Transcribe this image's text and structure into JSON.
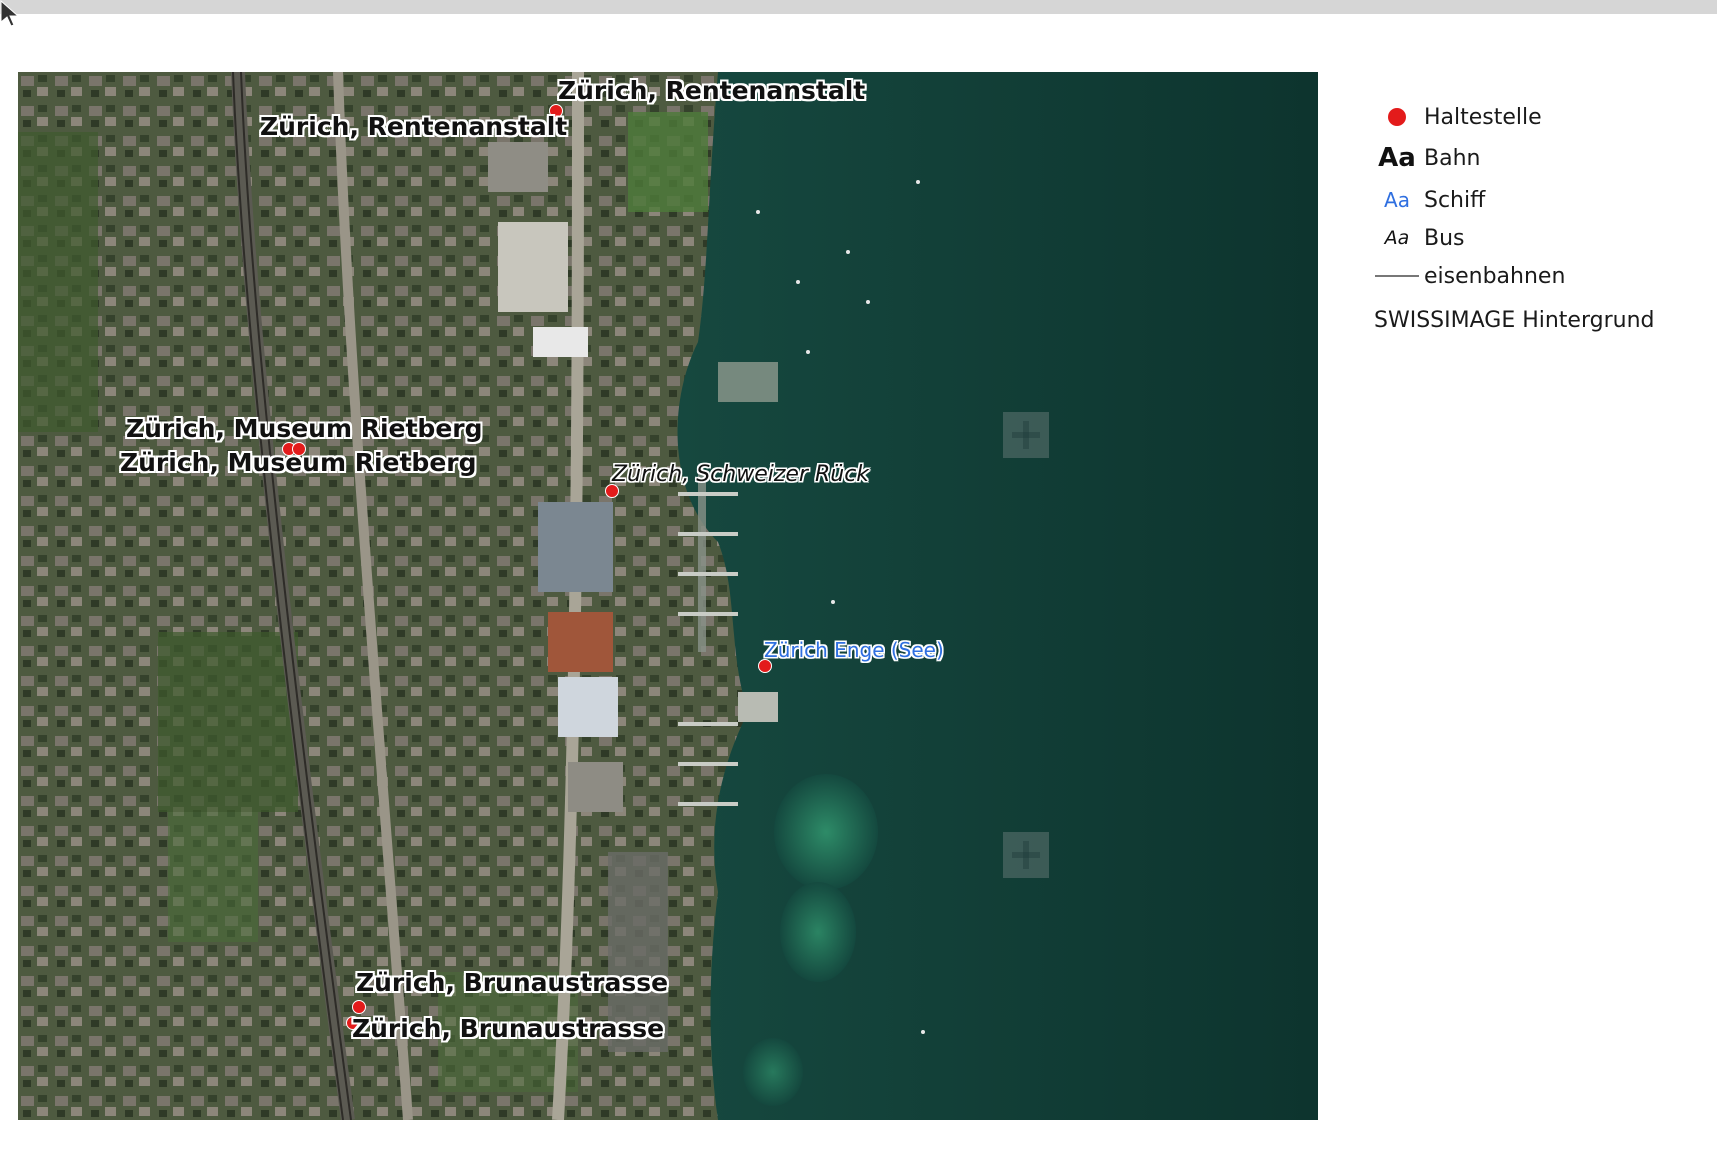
{
  "map": {
    "stops": {
      "rentenanstalt": {
        "label_top": "Zürich, Rentenanstalt",
        "label_bottom": "Zürich, Rentenanstalt"
      },
      "museum_rietberg": {
        "label_top": "Zürich, Museum Rietberg",
        "label_bottom": "Zürich, Museum Rietberg"
      },
      "schweizer_rueck": {
        "label": "Zürich, Schweizer Rück"
      },
      "enge_see": {
        "label": "Zürich Enge (See)"
      },
      "brunaustrasse": {
        "label_top": "Zürich, Brunaustrasse",
        "label_bottom": "Zürich, Brunaustrasse"
      }
    },
    "colors": {
      "stop": "#e31b1b",
      "schiff_label": "#2f6fe0",
      "lake": "#0f3b34",
      "land": "#4a5a3c"
    }
  },
  "legend": {
    "items": [
      {
        "icon": "red-dot",
        "label": "Haltestelle"
      },
      {
        "icon": "text-bold-aa",
        "label": "Bahn",
        "symbol": "Aa"
      },
      {
        "icon": "text-blue-aa",
        "label": "Schiff",
        "symbol": "Aa"
      },
      {
        "icon": "text-italic-aa",
        "label": "Bus",
        "symbol": "Aa"
      },
      {
        "icon": "line",
        "label": "eisenbahnen"
      }
    ],
    "background_layer": "SWISSIMAGE Hintergrund"
  }
}
